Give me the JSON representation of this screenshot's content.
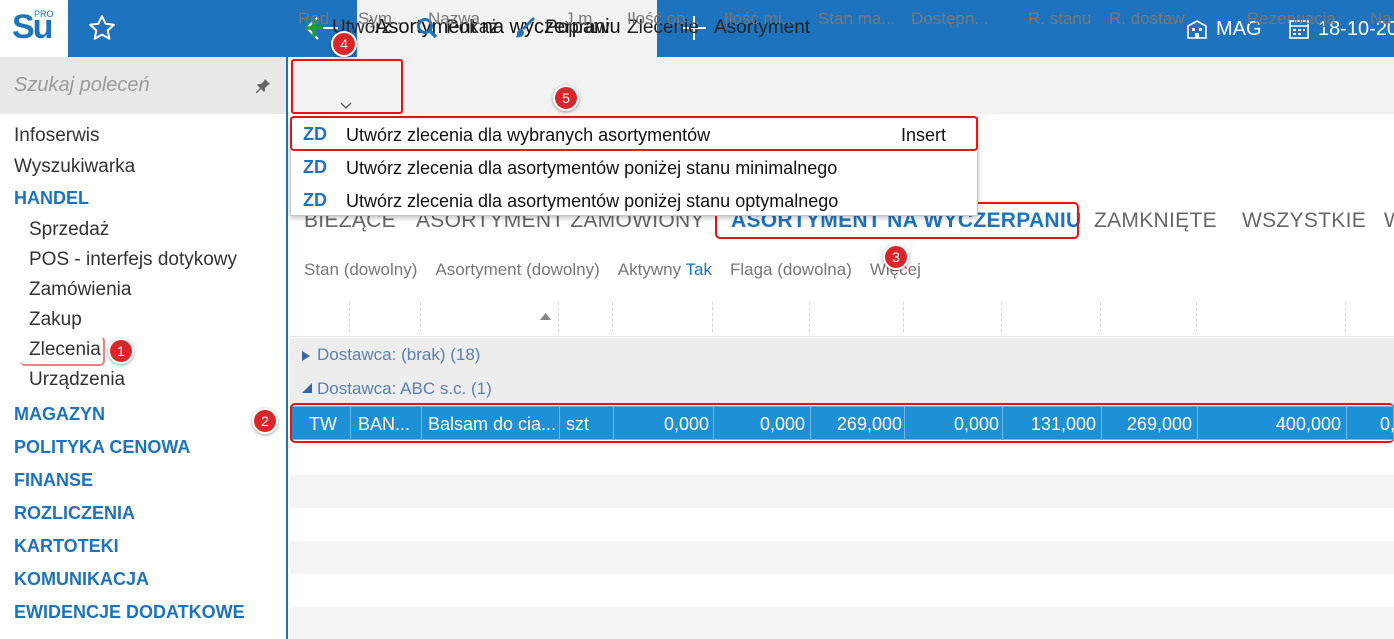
{
  "app": {
    "logo_main": "Su",
    "logo_sup": "PRO"
  },
  "topbar": {
    "active_tab": "Asortyment na wyczerpaniu",
    "warehouse": "MAG",
    "date": "18-10-20"
  },
  "sidebar": {
    "search_placeholder": "Szukaj poleceń",
    "top_items": [
      "Infoserwis",
      "Wyszukiwarka"
    ],
    "handel": {
      "label": "HANDEL",
      "items": [
        "Sprzedaż",
        "POS - interfejs dotykowy",
        "Zamówienia",
        "Zakup",
        "Zlecenia",
        "Urządzenia"
      ]
    },
    "sections": [
      "MAGAZYN",
      "POLITYKA CENOWA",
      "FINANSE",
      "ROZLICZENIA",
      "KARTOTEKI",
      "KOMUNIKACJA",
      "EWIDENCJE DODATKOWE"
    ]
  },
  "toolbar": {
    "create": "Utwórz",
    "show": "Pokaż",
    "edit": "Popraw",
    "order": "Zlecenie",
    "assortment": "Asortyment"
  },
  "dropdown": {
    "items": [
      {
        "badge": "ZD",
        "label": "Utwórz zlecenia dla wybranych asortymentów",
        "shortcut": "Insert"
      },
      {
        "badge": "ZD",
        "label": "Utwórz zlecenia dla asortymentów poniżej stanu minimalnego",
        "shortcut": ""
      },
      {
        "badge": "ZD",
        "label": "Utwórz zlecenia dla asortymentów poniżej stanu optymalnego",
        "shortcut": ""
      }
    ]
  },
  "view_tabs": [
    "BIEŻĄCE",
    "ASORTYMENT ZAMÓWIONY",
    "ASORTYMENT NA WYCZERPANIU",
    "ZAMKNIĘTE",
    "WSZYSTKIE",
    "W"
  ],
  "filters": {
    "stan": "Stan (dowolny)",
    "asortyment": "Asortyment (dowolny)",
    "aktywny_label": "Aktywny",
    "aktywny_value": "Tak",
    "flaga": "Flaga (dowolna)",
    "more": "Więcej"
  },
  "grid": {
    "columns": [
      "Rod...",
      "Sym...",
      "Nazwa",
      "J.m.",
      "Ilość op...",
      "Ilość mi...",
      "Stan ma...",
      "Dostępn...",
      "R. stanu",
      "R. dostaw",
      "Rezerwacja",
      "Na"
    ],
    "groups": [
      {
        "label": "Dostawca: (brak) (18)",
        "expanded": false
      },
      {
        "label": "Dostawca: ABC s.c. (1)",
        "expanded": true
      }
    ],
    "row": [
      "TW",
      "BAN...",
      "Balsam do cia...",
      "szt",
      "0,000",
      "0,000",
      "269,000",
      "0,000",
      "131,000",
      "269,000",
      "400,000",
      "0,"
    ]
  },
  "badges": [
    "1",
    "2",
    "3",
    "4",
    "5"
  ],
  "colors": {
    "primary": "#1e73be",
    "selected_row": "#1e90d6",
    "annotation": "#d9262b"
  }
}
